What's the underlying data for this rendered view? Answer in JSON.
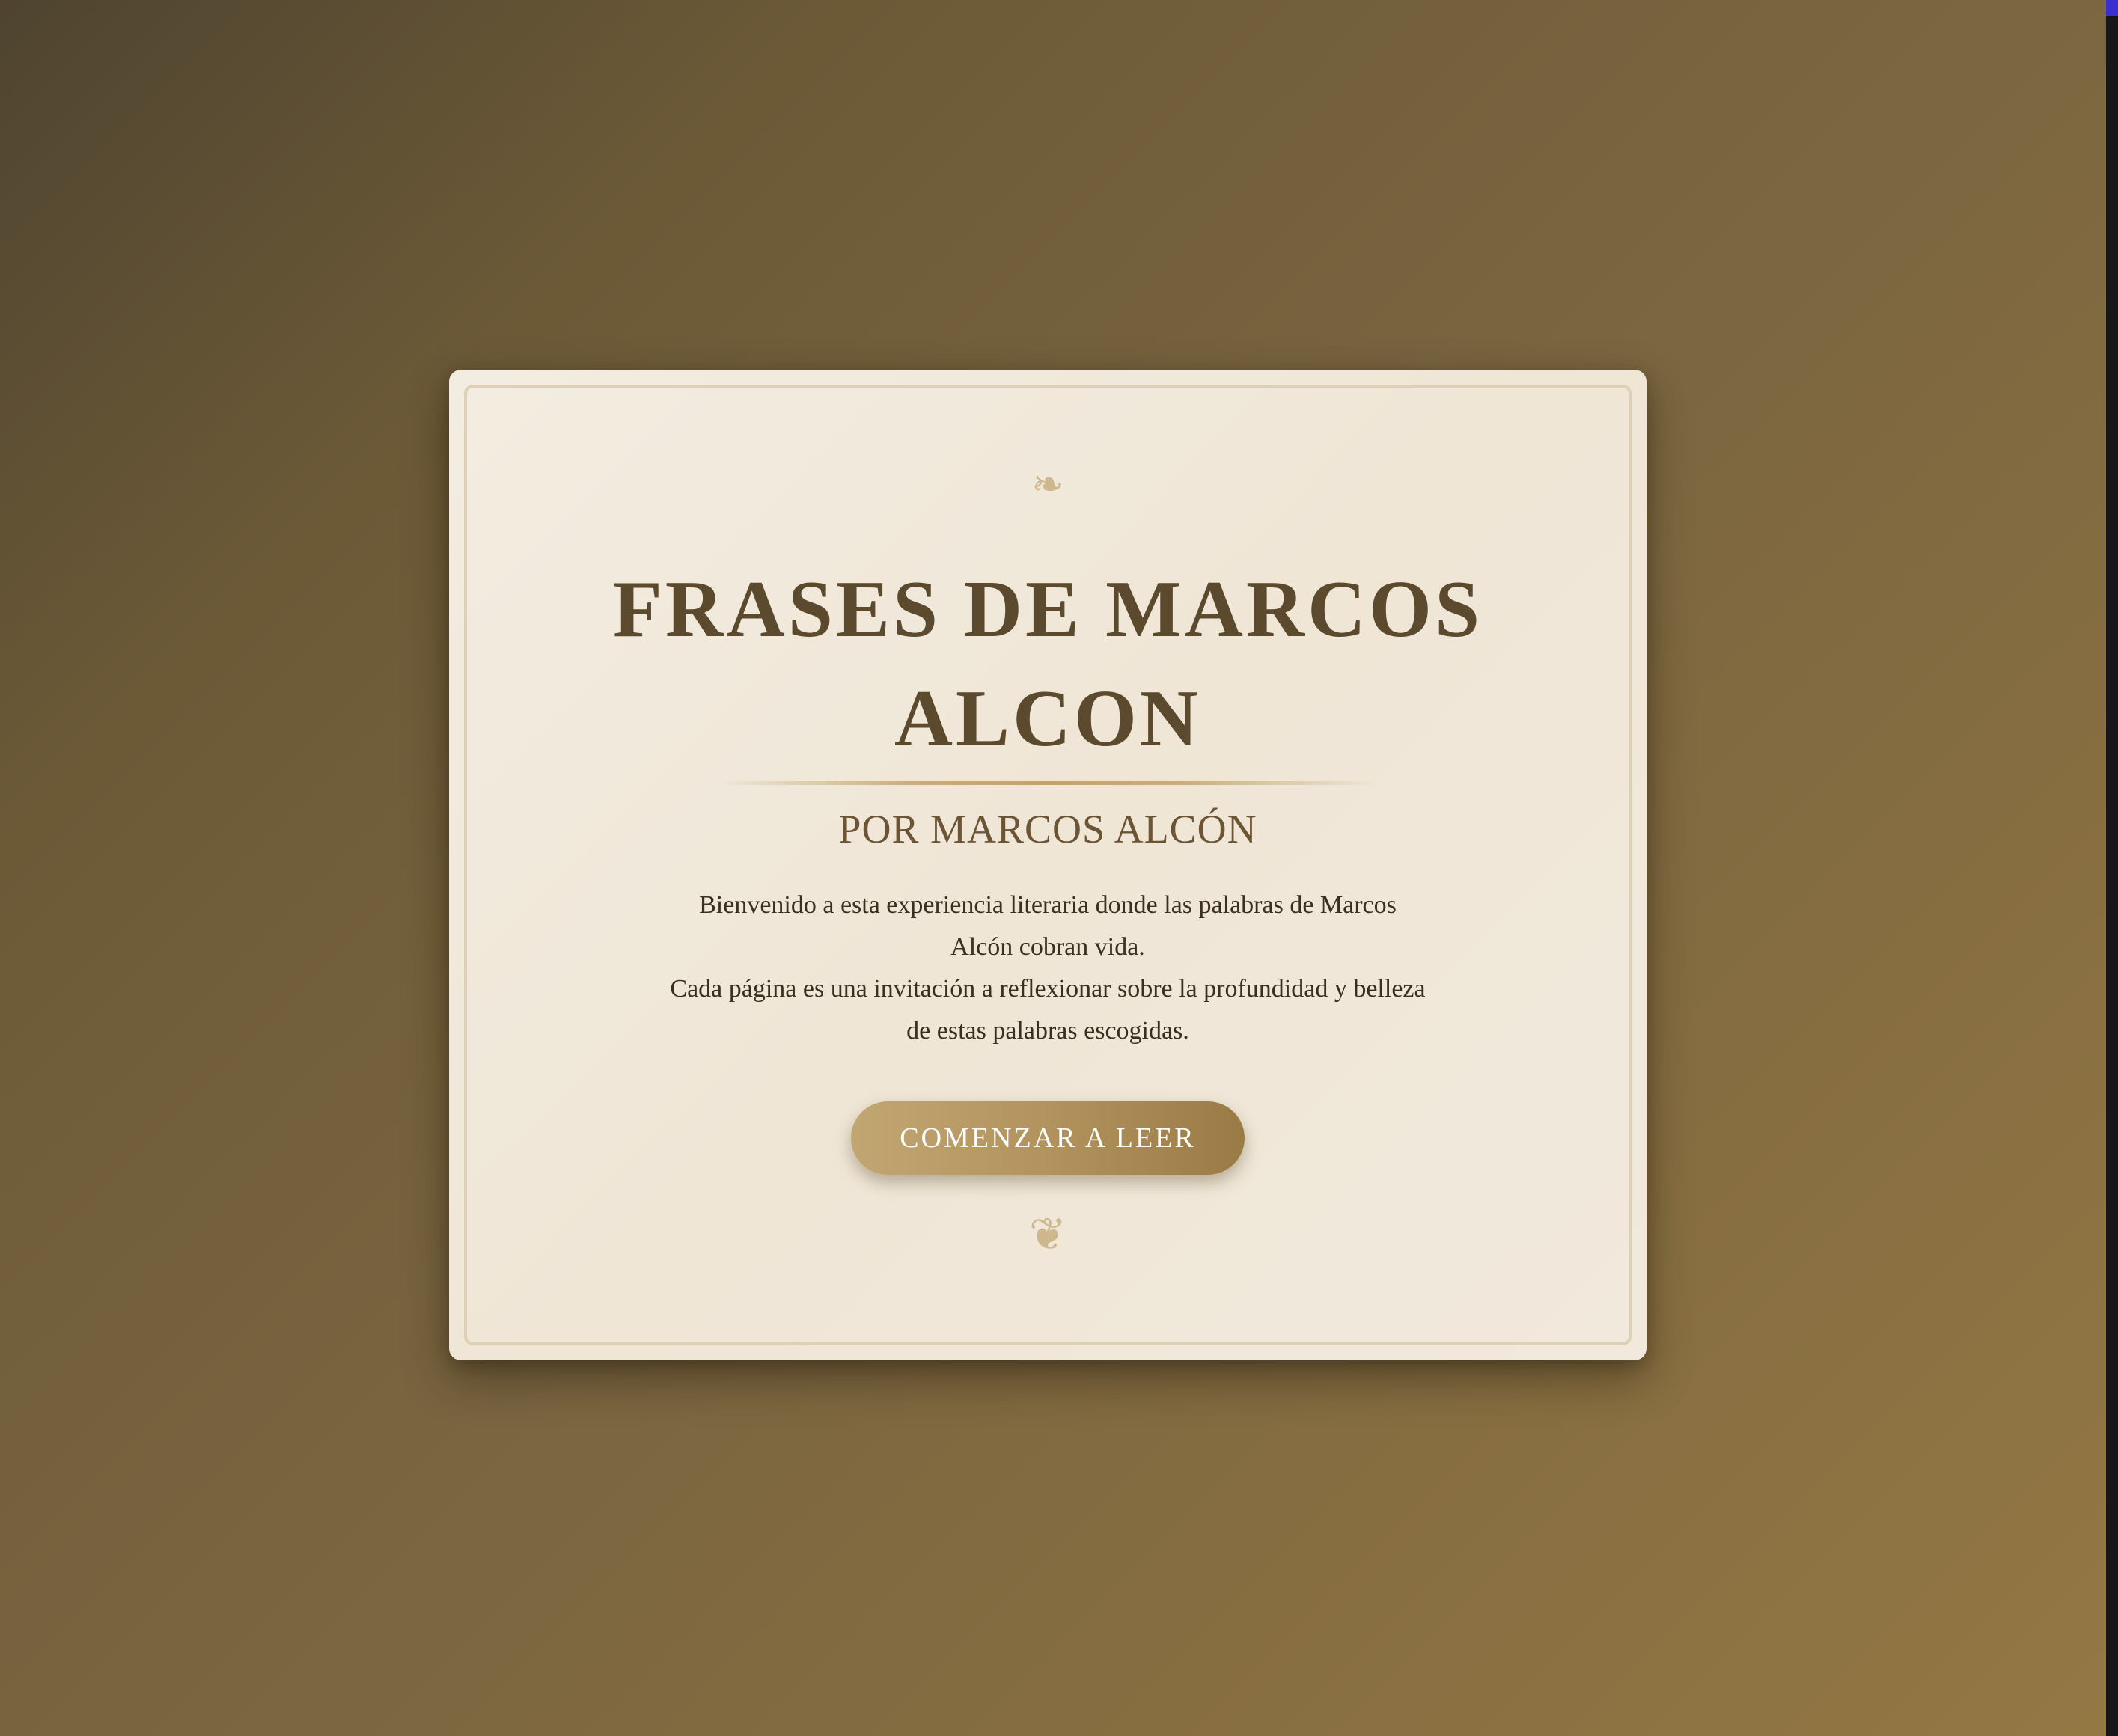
{
  "welcome_card": {
    "ornament_top": "❧",
    "title": "FRASES DE MARCOS ALCON",
    "subtitle": "POR MARCOS ALCÓN",
    "intro_paragraph_1": "Bienvenido a esta experiencia literaria donde las palabras de Marcos Alcón cobran vida.",
    "intro_paragraph_2": "Cada página es una invitación a reflexionar sobre la profundidad y belleza de estas palabras escogidas.",
    "cta_label": "COMENZAR A LEER",
    "ornament_bottom": "❦"
  },
  "icons": {
    "ornament_top": "floral-heart-icon",
    "ornament_bottom": "rotated-floral-heart-icon"
  },
  "colors": {
    "background_start": "#4f4430",
    "background_end": "#947844",
    "card": "#f1e9dc",
    "title": "#5b4a2d",
    "accent_gold": "#c2a672",
    "ornament": "#cdb78c"
  }
}
